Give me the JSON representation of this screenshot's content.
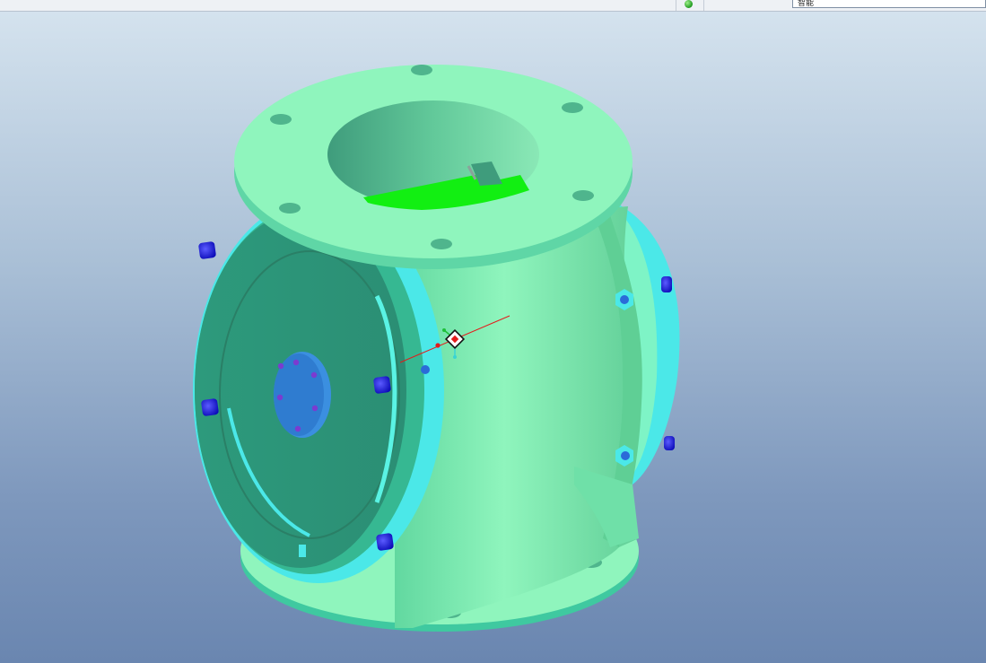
{
  "app": {
    "status_bar": {
      "status_indicator_color": "#2fb82f",
      "filter_value": "智能"
    },
    "viewport": {
      "background_top": "#d6e4ef",
      "background_bottom": "#6a86b0",
      "model_name": "",
      "model_colors": {
        "body": "#8ff5bd",
        "body_shadow": "#3f9c7c",
        "cover": "#2e957a",
        "flange_edge": "#4be8e8",
        "bolts": "#1a1aee",
        "rotor": "#12ef12"
      },
      "icons": [
        "coordinate-system-icon",
        "status-light-icon"
      ]
    }
  }
}
